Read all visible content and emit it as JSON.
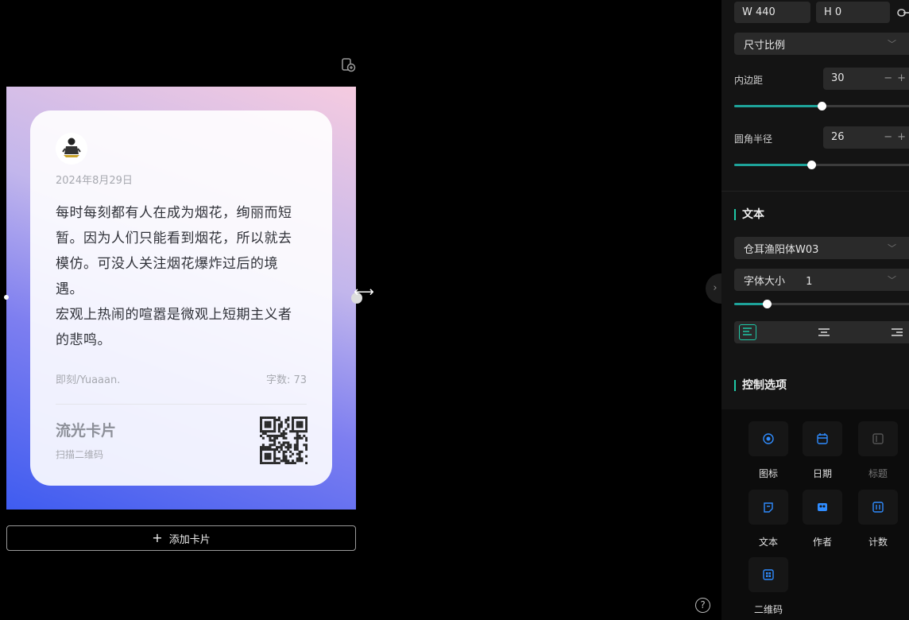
{
  "card": {
    "date": "2024年8月29日",
    "text": "每时每刻都有人在成为烟花，绚丽而短暂。因为人们只能看到烟花，所以就去模仿。可没人关注烟花爆炸过后的境遇。\n宏观上热闹的喧嚣是微观上短期主义者的悲鸣。",
    "author": "即刻/Yuaaan.",
    "word_count": "字数: 73",
    "brand": "流光卡片",
    "scan_hint": "扫描二维码"
  },
  "add_card_label": "添加卡片",
  "panel": {
    "width_value": "W 440",
    "height_value": "H 0",
    "ratio_select": "尺寸比例",
    "padding": {
      "label": "内边距",
      "value": "30",
      "pm": "−+",
      "level": 0.48
    },
    "radius": {
      "label": "圆角半径",
      "value": "26",
      "pm": "−+",
      "level": 0.42
    },
    "text_section": {
      "title": "文本",
      "font_select": "仓耳渔阳体W03",
      "font_size_label": "字体大小",
      "font_size_value": "1",
      "font_size_level": 0.18
    },
    "controls_section": {
      "title": "控制选项",
      "items": [
        {
          "label": "图标",
          "icon": "icon-toggle-icon",
          "active": true
        },
        {
          "label": "日期",
          "icon": "calendar-icon",
          "active": true
        },
        {
          "label": "标题",
          "icon": "title-icon",
          "active": false
        },
        {
          "label": "文本",
          "icon": "text-icon",
          "active": true
        },
        {
          "label": "作者",
          "icon": "author-icon",
          "active": true
        },
        {
          "label": "计数",
          "icon": "counter-icon",
          "active": true
        },
        {
          "label": "二维码",
          "icon": "qrcode-icon",
          "active": true
        }
      ]
    }
  },
  "colors": {
    "accent": "#1ea39a",
    "icon_blue": "#2f8cff",
    "panel_bg": "#141414"
  }
}
